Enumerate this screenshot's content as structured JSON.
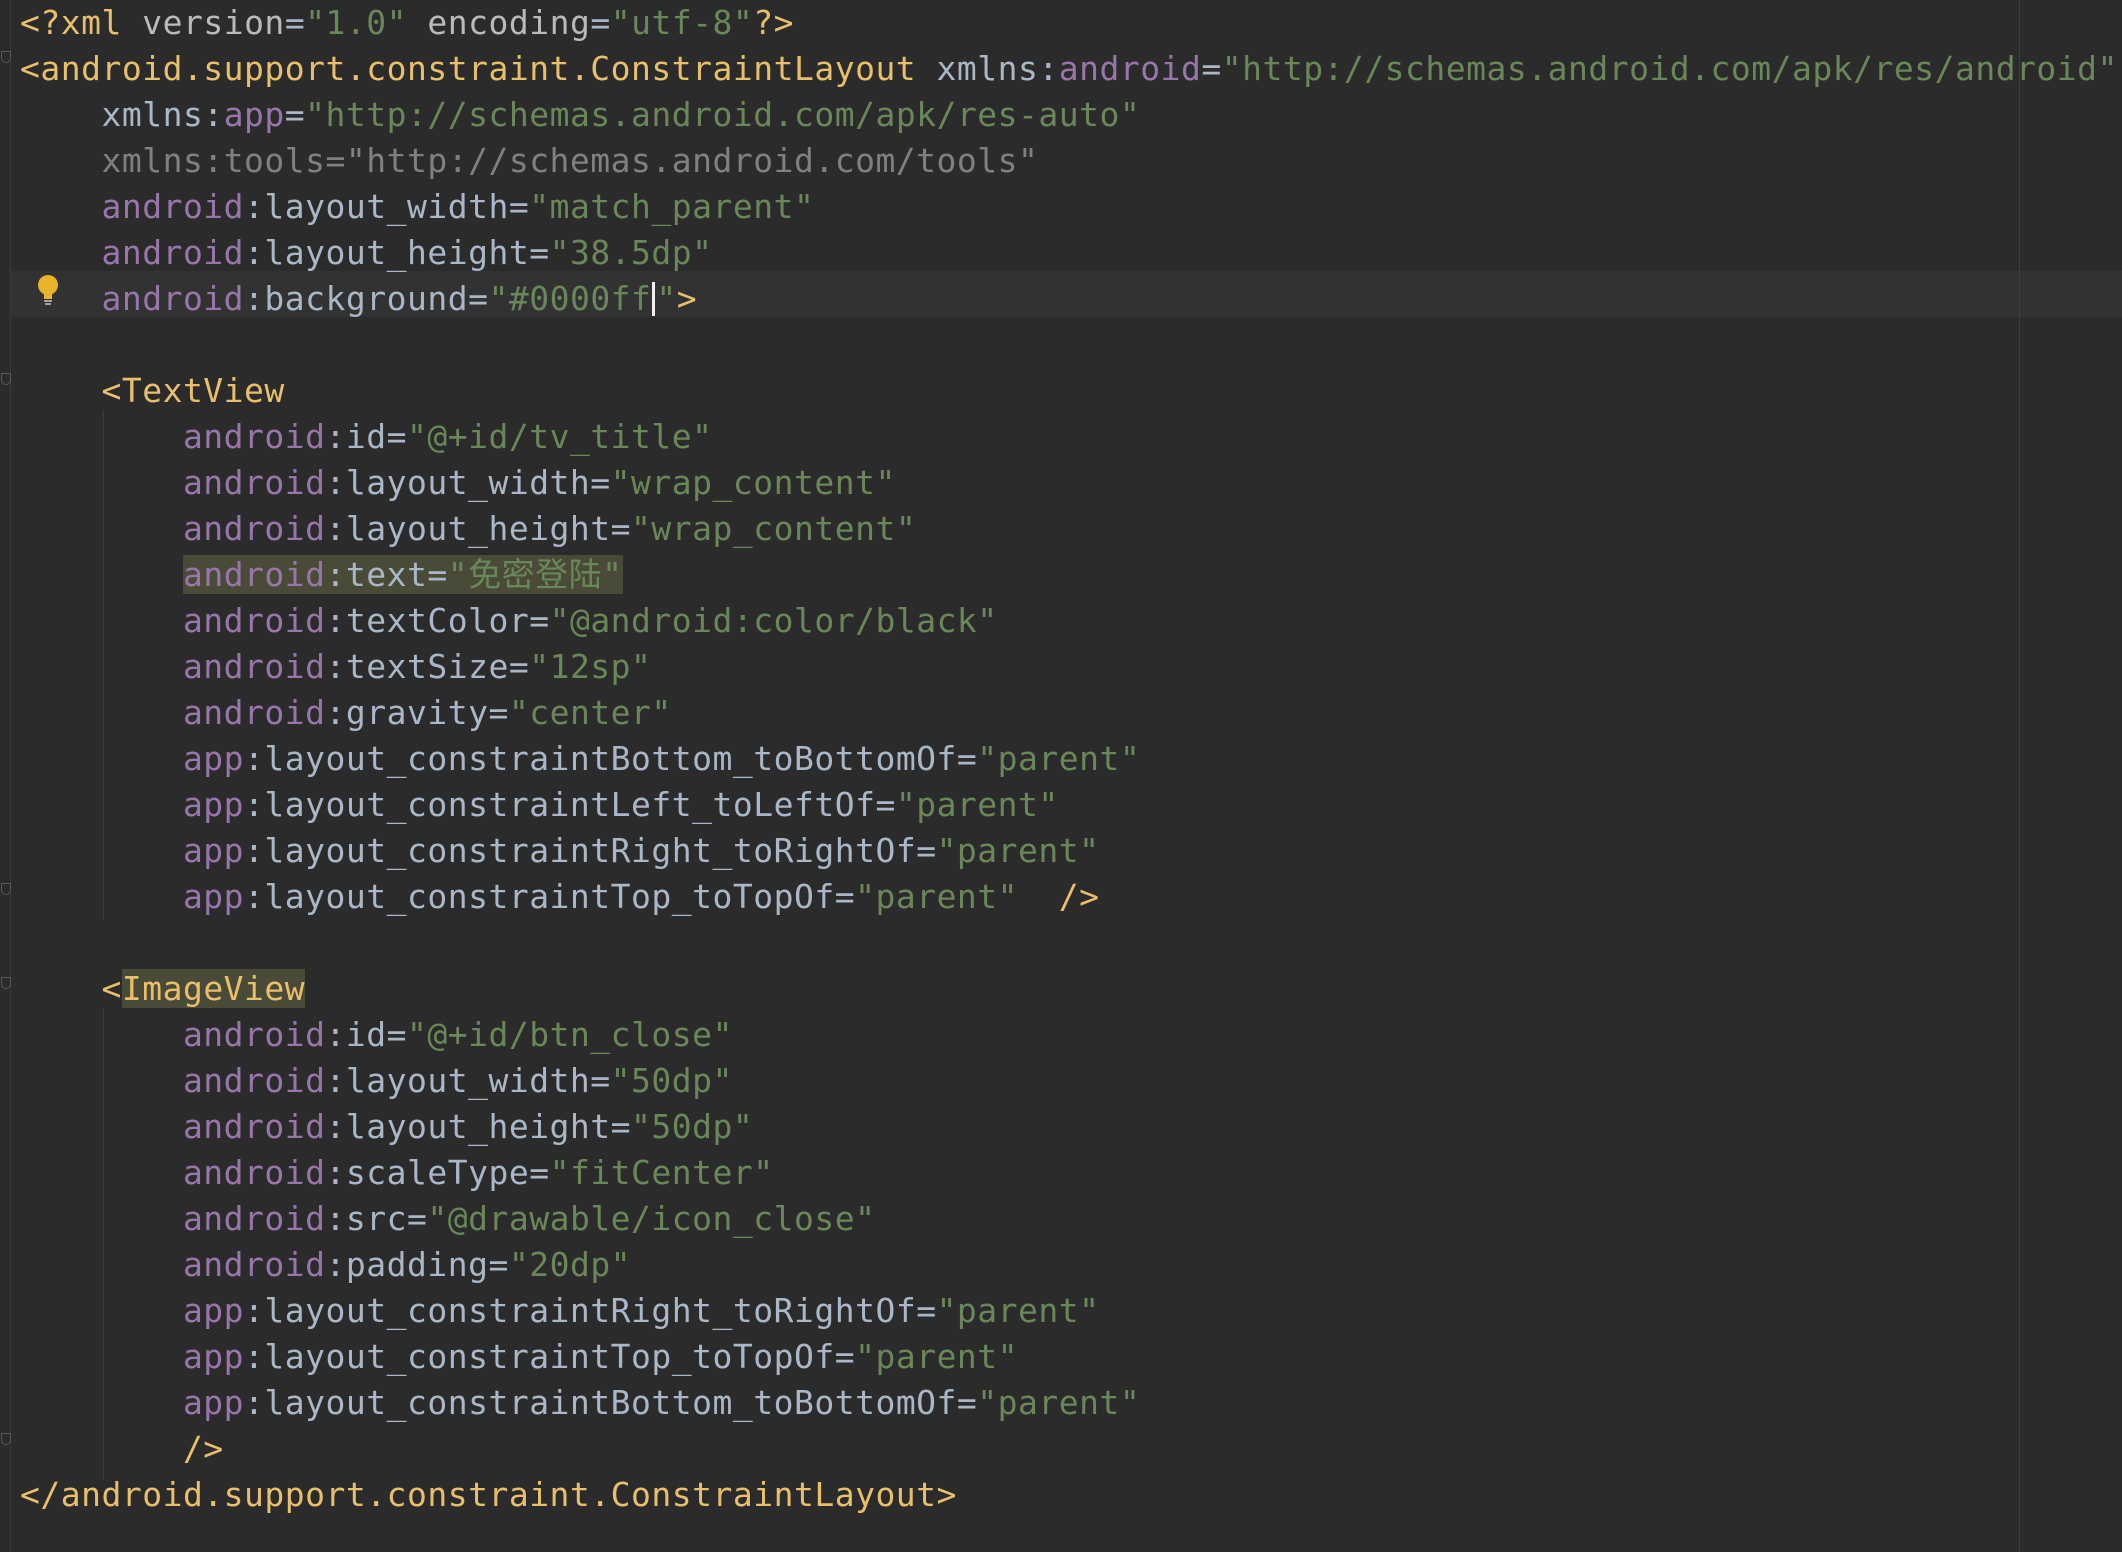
{
  "editor": {
    "lines": [
      {
        "id": "l1",
        "segs": [
          [
            "pi",
            "<?"
          ],
          [
            "pi",
            "xml"
          ],
          [
            "attr",
            " version"
          ],
          [
            "plain",
            "="
          ],
          [
            "str",
            "\"1.0\""
          ],
          [
            "attr",
            " encoding"
          ],
          [
            "plain",
            "="
          ],
          [
            "str",
            "\"utf-8\""
          ],
          [
            "pi",
            "?>"
          ]
        ]
      },
      {
        "id": "l2",
        "segs": [
          [
            "tag",
            "<android.support.constraint.ConstraintLayout"
          ],
          [
            "plain",
            " xmlns:"
          ],
          [
            "ns",
            "android"
          ],
          [
            "plain",
            "="
          ],
          [
            "str",
            "\"http://schemas.android.com/apk/res/android\""
          ]
        ]
      },
      {
        "id": "l3",
        "segs": [
          [
            "plain",
            "    xmlns:"
          ],
          [
            "ns",
            "app"
          ],
          [
            "plain",
            "="
          ],
          [
            "str",
            "\"http://schemas.android.com/apk/res-auto\""
          ]
        ]
      },
      {
        "id": "l4",
        "segs": [
          [
            "dim",
            "    xmlns:tools=\"http://schemas.android.com/tools\""
          ]
        ]
      },
      {
        "id": "l5",
        "segs": [
          [
            "ns",
            "    android"
          ],
          [
            "plain",
            ":layout_width"
          ],
          [
            "plain",
            "="
          ],
          [
            "str",
            "\"match_parent\""
          ]
        ]
      },
      {
        "id": "l6",
        "segs": [
          [
            "ns",
            "    android"
          ],
          [
            "plain",
            ":layout_height"
          ],
          [
            "plain",
            "="
          ],
          [
            "str",
            "\"38.5dp\""
          ]
        ]
      },
      {
        "id": "l7",
        "segs": [
          [
            "ns",
            "    android"
          ],
          [
            "plain",
            ":background"
          ],
          [
            "plain",
            "="
          ],
          [
            "str",
            "\""
          ],
          [
            "str",
            "#0000ff"
          ],
          [
            "caret",
            ""
          ],
          [
            "str",
            "\""
          ],
          [
            "tag",
            ">"
          ]
        ]
      },
      {
        "id": "l8",
        "segs": [
          [
            "plain",
            ""
          ]
        ]
      },
      {
        "id": "l9",
        "segs": [
          [
            "tag",
            "    <TextView"
          ]
        ]
      },
      {
        "id": "l10",
        "segs": [
          [
            "ns",
            "        android"
          ],
          [
            "plain",
            ":id"
          ],
          [
            "plain",
            "="
          ],
          [
            "str",
            "\"@+id/tv_title\""
          ]
        ]
      },
      {
        "id": "l11",
        "segs": [
          [
            "ns",
            "        android"
          ],
          [
            "plain",
            ":layout_width"
          ],
          [
            "plain",
            "="
          ],
          [
            "str",
            "\"wrap_content\""
          ]
        ]
      },
      {
        "id": "l12",
        "segs": [
          [
            "ns",
            "        android"
          ],
          [
            "plain",
            ":layout_height"
          ],
          [
            "plain",
            "="
          ],
          [
            "str",
            "\"wrap_content\""
          ]
        ]
      },
      {
        "id": "l13",
        "hl": true,
        "segs": [
          [
            "ns",
            "        "
          ],
          [
            "nshl",
            "android"
          ],
          [
            "plainhl",
            ":text"
          ],
          [
            "plainhl",
            "="
          ],
          [
            "strhl",
            "\"免密登陆\""
          ]
        ]
      },
      {
        "id": "l14",
        "segs": [
          [
            "ns",
            "        android"
          ],
          [
            "plain",
            ":textColor"
          ],
          [
            "plain",
            "="
          ],
          [
            "str",
            "\"@android:color/black\""
          ]
        ]
      },
      {
        "id": "l15",
        "segs": [
          [
            "ns",
            "        android"
          ],
          [
            "plain",
            ":textSize"
          ],
          [
            "plain",
            "="
          ],
          [
            "str",
            "\"12sp\""
          ]
        ]
      },
      {
        "id": "l16",
        "segs": [
          [
            "ns",
            "        android"
          ],
          [
            "plain",
            ":gravity"
          ],
          [
            "plain",
            "="
          ],
          [
            "str",
            "\"center\""
          ]
        ]
      },
      {
        "id": "l17",
        "segs": [
          [
            "ns",
            "        app"
          ],
          [
            "plain",
            ":layout_constraintBottom_toBottomOf"
          ],
          [
            "plain",
            "="
          ],
          [
            "str",
            "\"parent\""
          ]
        ]
      },
      {
        "id": "l18",
        "segs": [
          [
            "ns",
            "        app"
          ],
          [
            "plain",
            ":layout_constraintLeft_toLeftOf"
          ],
          [
            "plain",
            "="
          ],
          [
            "str",
            "\"parent\""
          ]
        ]
      },
      {
        "id": "l19",
        "segs": [
          [
            "ns",
            "        app"
          ],
          [
            "plain",
            ":layout_constraintRight_toRightOf"
          ],
          [
            "plain",
            "="
          ],
          [
            "str",
            "\"parent\""
          ]
        ]
      },
      {
        "id": "l20",
        "segs": [
          [
            "ns",
            "        app"
          ],
          [
            "plain",
            ":layout_constraintTop_toTopOf"
          ],
          [
            "plain",
            "="
          ],
          [
            "str",
            "\"parent\""
          ],
          [
            "tag",
            "  />"
          ]
        ]
      },
      {
        "id": "l21",
        "segs": [
          [
            "plain",
            ""
          ]
        ]
      },
      {
        "id": "l22",
        "segs": [
          [
            "tag",
            "    <"
          ],
          [
            "taghl",
            "ImageView"
          ]
        ]
      },
      {
        "id": "l23",
        "segs": [
          [
            "ns",
            "        android"
          ],
          [
            "plain",
            ":id"
          ],
          [
            "plain",
            "="
          ],
          [
            "str",
            "\"@+id/btn_close\""
          ]
        ]
      },
      {
        "id": "l24",
        "segs": [
          [
            "ns",
            "        android"
          ],
          [
            "plain",
            ":layout_width"
          ],
          [
            "plain",
            "="
          ],
          [
            "str",
            "\"50dp\""
          ]
        ]
      },
      {
        "id": "l25",
        "segs": [
          [
            "ns",
            "        android"
          ],
          [
            "plain",
            ":layout_height"
          ],
          [
            "plain",
            "="
          ],
          [
            "str",
            "\"50dp\""
          ]
        ]
      },
      {
        "id": "l26",
        "segs": [
          [
            "ns",
            "        android"
          ],
          [
            "plain",
            ":scaleType"
          ],
          [
            "plain",
            "="
          ],
          [
            "str",
            "\"fitCenter\""
          ]
        ]
      },
      {
        "id": "l27",
        "segs": [
          [
            "ns",
            "        android"
          ],
          [
            "plain",
            ":src"
          ],
          [
            "plain",
            "="
          ],
          [
            "str",
            "\"@drawable/icon_close\""
          ]
        ]
      },
      {
        "id": "l28",
        "segs": [
          [
            "ns",
            "        android"
          ],
          [
            "plain",
            ":padding"
          ],
          [
            "plain",
            "="
          ],
          [
            "str",
            "\"20dp\""
          ]
        ]
      },
      {
        "id": "l29",
        "segs": [
          [
            "ns",
            "        app"
          ],
          [
            "plain",
            ":layout_constraintRight_toRightOf"
          ],
          [
            "plain",
            "="
          ],
          [
            "str",
            "\"parent\""
          ]
        ]
      },
      {
        "id": "l30",
        "segs": [
          [
            "ns",
            "        app"
          ],
          [
            "plain",
            ":layout_constraintTop_toTopOf"
          ],
          [
            "plain",
            "="
          ],
          [
            "str",
            "\"parent\""
          ]
        ]
      },
      {
        "id": "l31",
        "segs": [
          [
            "ns",
            "        app"
          ],
          [
            "plain",
            ":layout_constraintBottom_toBottomOf"
          ],
          [
            "plain",
            "="
          ],
          [
            "str",
            "\"parent\""
          ]
        ]
      },
      {
        "id": "l32",
        "segs": [
          [
            "tag",
            "        />"
          ]
        ]
      },
      {
        "id": "l33",
        "segs": [
          [
            "tag",
            "</android.support.constraint.ConstraintLayout>"
          ]
        ]
      }
    ],
    "colors": {
      "background": "#2b2b2b",
      "tag": "#e8bf6a",
      "namespace": "#9876aa",
      "string": "#6a8759",
      "text": "#a9b7c6",
      "dim": "#808080",
      "highlight": "#4a4a38",
      "bulb": "#e8b429"
    },
    "icons": {
      "intention": "lightbulb-icon",
      "fold": "fold-marker-icon"
    }
  }
}
